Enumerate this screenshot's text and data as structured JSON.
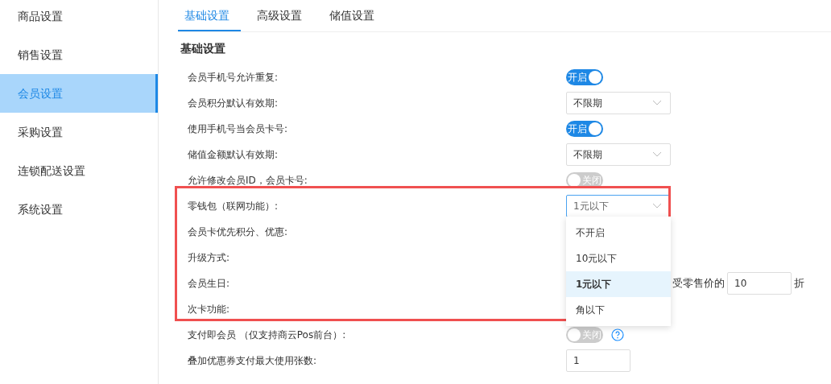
{
  "sidebar": {
    "items": [
      {
        "label": "商品设置",
        "selected": false
      },
      {
        "label": "销售设置",
        "selected": false
      },
      {
        "label": "会员设置",
        "selected": true
      },
      {
        "label": "采购设置",
        "selected": false
      },
      {
        "label": "连锁配送设置",
        "selected": false
      },
      {
        "label": "系统设置",
        "selected": false
      }
    ]
  },
  "tabs": [
    {
      "label": "基础设置",
      "selected": true
    },
    {
      "label": "高级设置",
      "selected": false
    },
    {
      "label": "储值设置",
      "selected": false
    }
  ],
  "section_title": "基础设置",
  "rows": [
    {
      "label": "会员手机号允许重复:",
      "kind": "toggle",
      "on": true,
      "text": "开启"
    },
    {
      "label": "会员积分默认有效期:",
      "kind": "select",
      "value": "不限期"
    },
    {
      "label": "使用手机号当会员卡号:",
      "kind": "toggle",
      "on": true,
      "text": "开启"
    },
    {
      "label": "储值金额默认有效期:",
      "kind": "select",
      "value": "不限期"
    },
    {
      "label": "允许修改会员ID，会员卡号:",
      "kind": "toggle",
      "on": false,
      "text": "关闭"
    },
    {
      "label": "零钱包（联网功能）:",
      "kind": "select",
      "value": "1元以下",
      "focused": true
    },
    {
      "label": "会员卡优先积分、优惠:",
      "kind": "none"
    },
    {
      "label": "升级方式:",
      "kind": "none"
    },
    {
      "label": "会员生日:",
      "kind": "discount",
      "text": "受零售价的",
      "value": "10",
      "suffix": "折"
    },
    {
      "label": "次卡功能:",
      "kind": "none"
    },
    {
      "label": "支付即会员 （仅支持商云Pos前台）:",
      "kind": "toggle",
      "on": false,
      "text": "关闭",
      "help": true
    },
    {
      "label": "叠加优惠券支付最大使用张数:",
      "kind": "input",
      "value": "1"
    }
  ],
  "dropdown": {
    "options": [
      {
        "label": "不开启",
        "selected": false
      },
      {
        "label": "10元以下",
        "selected": false
      },
      {
        "label": "1元以下",
        "selected": true
      },
      {
        "label": "角以下",
        "selected": false
      }
    ]
  }
}
